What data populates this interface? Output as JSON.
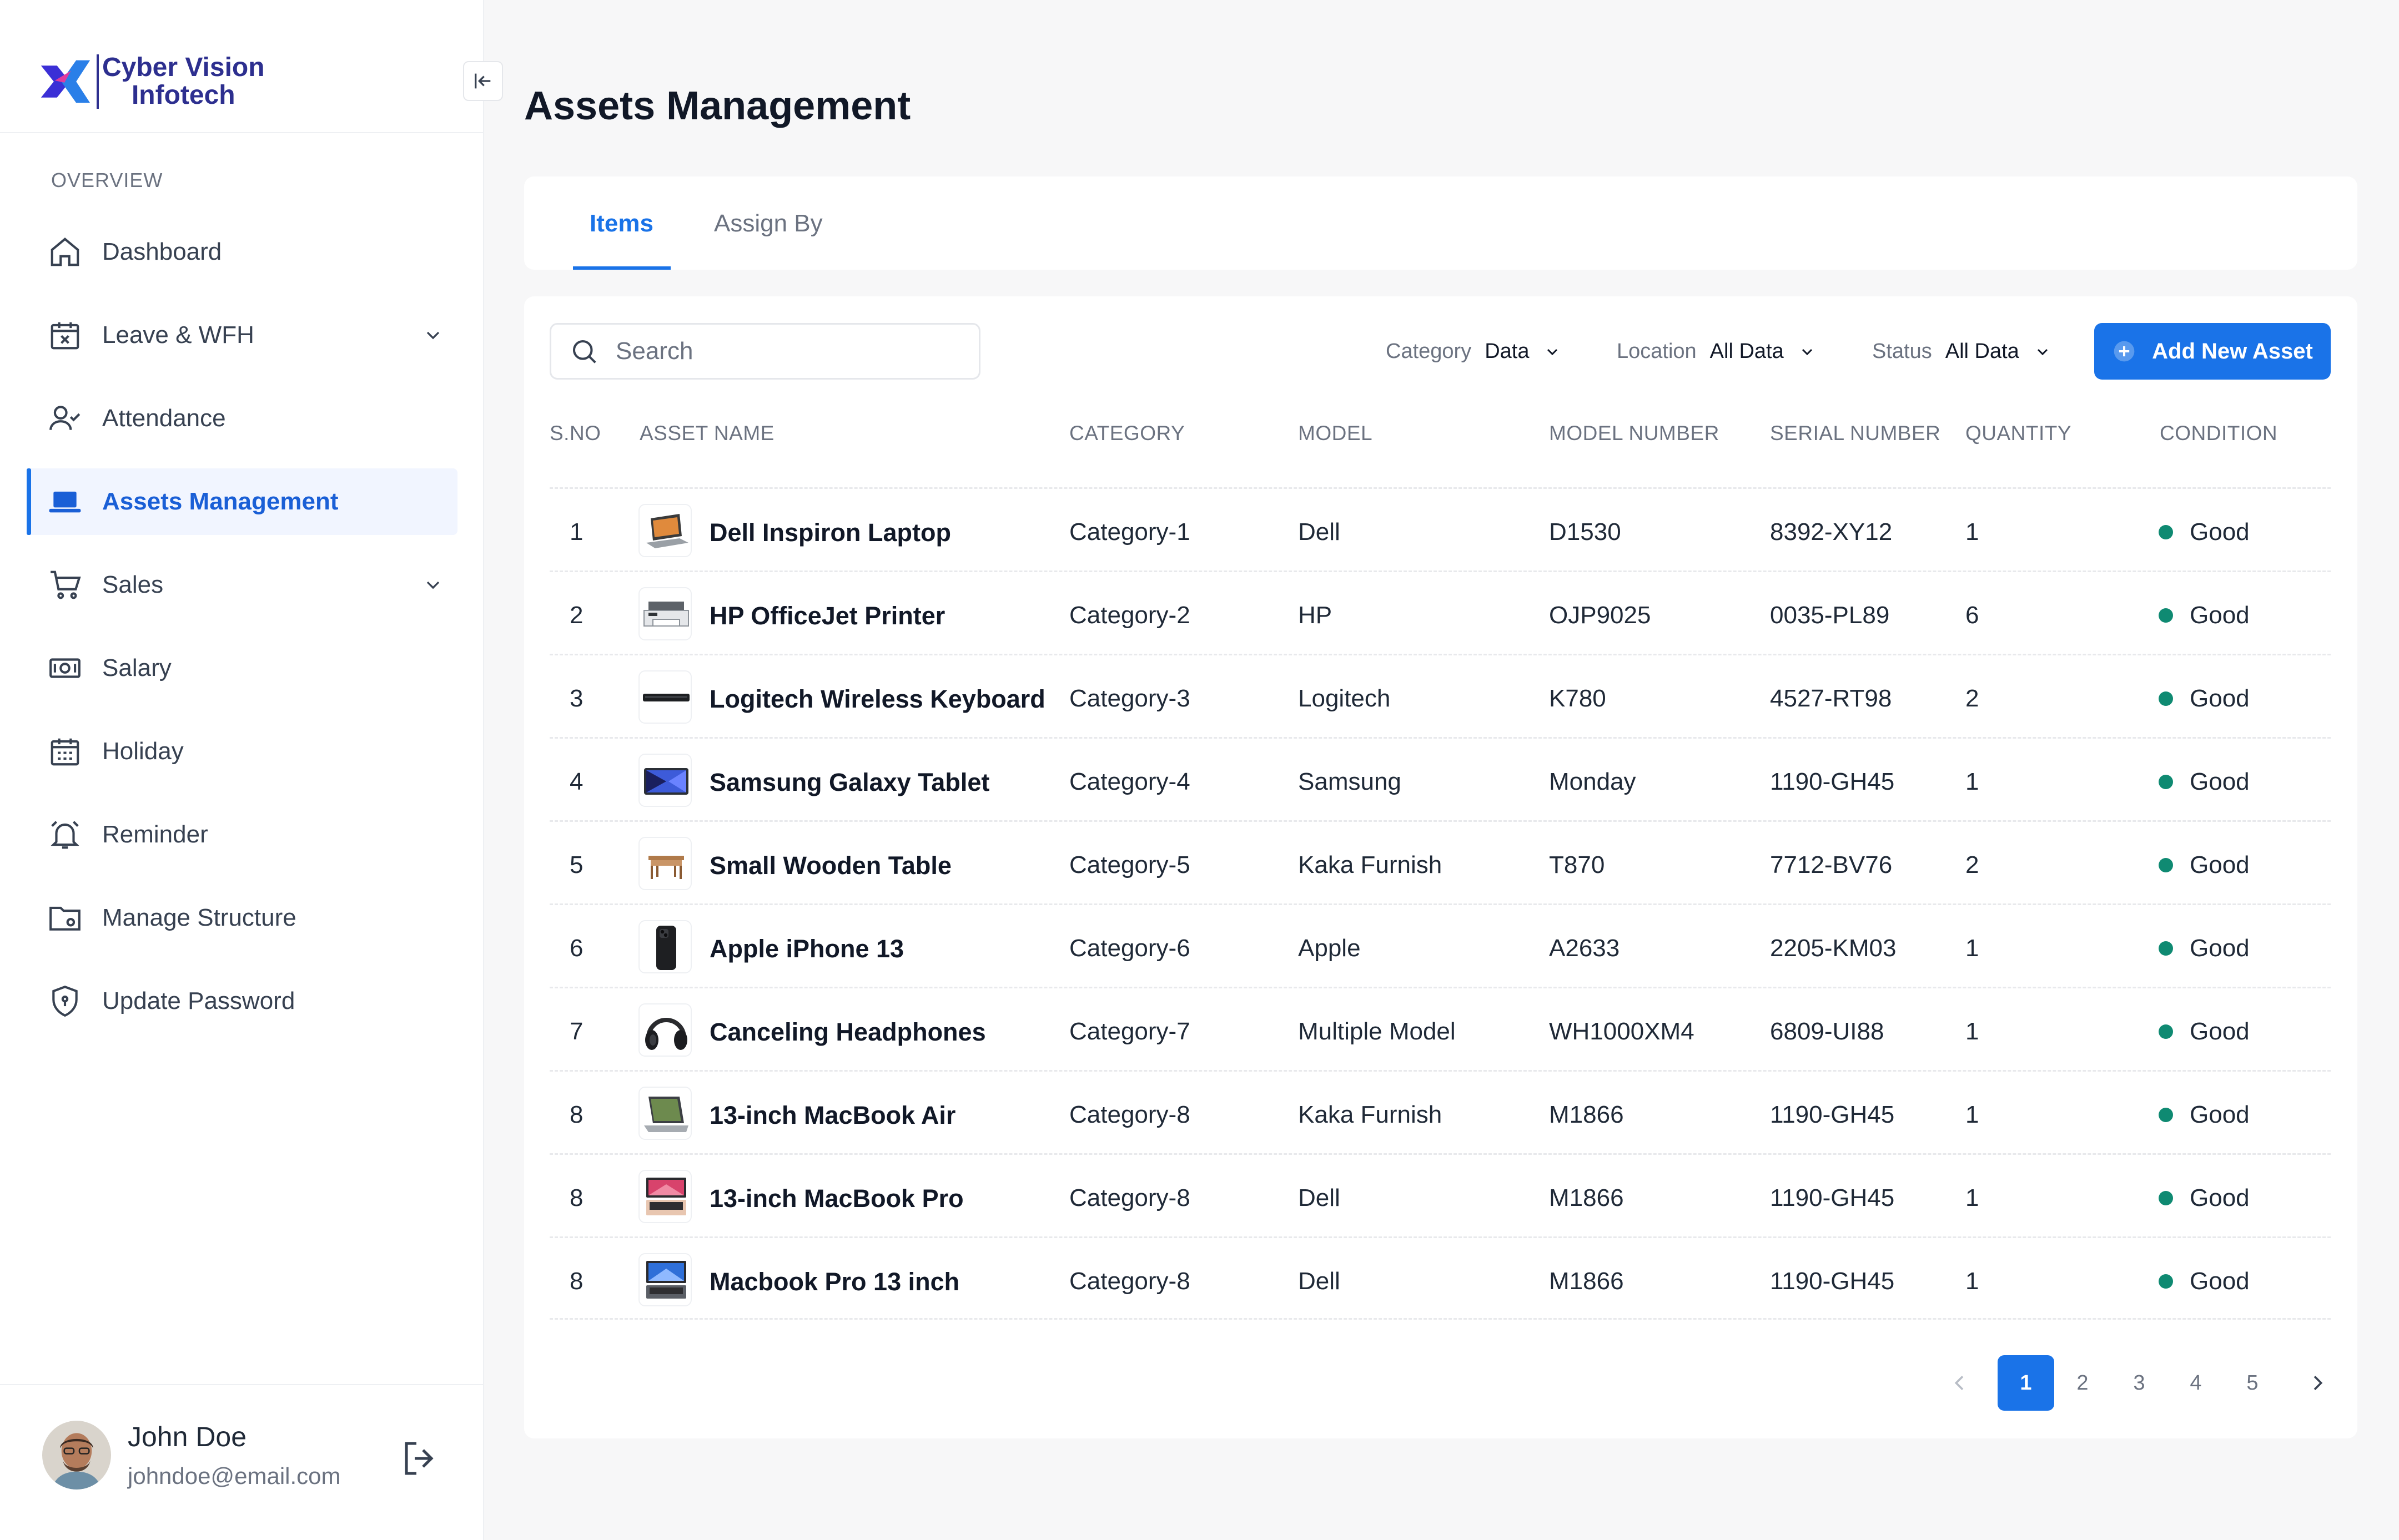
{
  "brand": {
    "line1": "Cyber Vision",
    "line2": "Infotech"
  },
  "sidebar": {
    "section_label": "OVERVIEW",
    "items": [
      {
        "label": "Dashboard",
        "icon": "home-icon"
      },
      {
        "label": "Leave & WFH",
        "icon": "calendar-x-icon",
        "expandable": true
      },
      {
        "label": "Attendance",
        "icon": "user-check-icon"
      },
      {
        "label": "Assets Management",
        "icon": "laptop-icon",
        "active": true
      },
      {
        "label": "Sales",
        "icon": "cart-icon",
        "expandable": true
      },
      {
        "label": "Salary",
        "icon": "money-icon"
      },
      {
        "label": "Holiday",
        "icon": "calendar-icon"
      },
      {
        "label": "Reminder",
        "icon": "bell-icon"
      },
      {
        "label": "Manage Structure",
        "icon": "folder-gear-icon"
      },
      {
        "label": "Update Password",
        "icon": "shield-lock-icon"
      }
    ]
  },
  "user": {
    "name": "John Doe",
    "email": "johndoe@email.com"
  },
  "page": {
    "title": "Assets Management"
  },
  "tabs": [
    {
      "label": "Items",
      "active": true
    },
    {
      "label": "Assign By",
      "active": false
    }
  ],
  "toolbar": {
    "search_placeholder": "Search",
    "filters": [
      {
        "label": "Category",
        "value": "Data"
      },
      {
        "label": "Location",
        "value": "All Data"
      },
      {
        "label": "Status",
        "value": "All Data"
      }
    ],
    "add_button_label": "Add New Asset"
  },
  "table": {
    "columns": [
      "S.NO",
      "ASSET NAME",
      "CATEGORY",
      "MODEL",
      "MODEL NUMBER",
      "SERIAL NUMBER",
      "QUANTITY",
      "CONDITION"
    ],
    "rows": [
      {
        "sno": "1",
        "name": "Dell Inspiron Laptop",
        "category": "Category-1",
        "model": "Dell",
        "model_number": "D1530",
        "serial": "8392-XY12",
        "qty": "1",
        "condition": "Good",
        "thumb": "laptop"
      },
      {
        "sno": "2",
        "name": "HP OfficeJet Printer",
        "category": "Category-2",
        "model": "HP",
        "model_number": "OJP9025",
        "serial": "0035-PL89",
        "qty": "6",
        "condition": "Good",
        "thumb": "printer"
      },
      {
        "sno": "3",
        "name": "Logitech Wireless Keyboard",
        "category": "Category-3",
        "model": "Logitech",
        "model_number": "K780",
        "serial": "4527-RT98",
        "qty": "2",
        "condition": "Good",
        "thumb": "keyboard"
      },
      {
        "sno": "4",
        "name": "Samsung Galaxy Tablet",
        "category": "Category-4",
        "model": "Samsung",
        "model_number": "Monday",
        "serial": "1190-GH45",
        "qty": "1",
        "condition": "Good",
        "thumb": "tablet"
      },
      {
        "sno": "5",
        "name": "Small Wooden Table",
        "category": "Category-5",
        "model": "Kaka Furnish",
        "model_number": "T870",
        "serial": "7712-BV76",
        "qty": "2",
        "condition": "Good",
        "thumb": "table"
      },
      {
        "sno": "6",
        "name": "Apple iPhone 13",
        "category": "Category-6",
        "model": "Apple",
        "model_number": "A2633",
        "serial": "2205-KM03",
        "qty": "1",
        "condition": "Good",
        "thumb": "phone"
      },
      {
        "sno": "7",
        "name": "Canceling Headphones",
        "category": "Category-7",
        "model": "Multiple Model",
        "model_number": "WH1000XM4",
        "serial": "6809-UI88",
        "qty": "1",
        "condition": "Good",
        "thumb": "headphones"
      },
      {
        "sno": "8",
        "name": "13-inch MacBook Air",
        "category": "Category-8",
        "model": "Kaka Furnish",
        "model_number": "M1866",
        "serial": "1190-GH45",
        "qty": "1",
        "condition": "Good",
        "thumb": "macbook-air"
      },
      {
        "sno": "8",
        "name": "13-inch MacBook Pro",
        "category": "Category-8",
        "model": "Dell",
        "model_number": "M1866",
        "serial": "1190-GH45",
        "qty": "1",
        "condition": "Good",
        "thumb": "macbook-pro"
      },
      {
        "sno": "8",
        "name": "Macbook Pro 13 inch",
        "category": "Category-8",
        "model": "Dell",
        "model_number": "M1866",
        "serial": "1190-GH45",
        "qty": "1",
        "condition": "Good",
        "thumb": "macbook-pro-blue"
      }
    ]
  },
  "pagination": {
    "pages": [
      "1",
      "2",
      "3",
      "4",
      "5"
    ],
    "current": "1"
  },
  "colors": {
    "accent": "#1a73e8",
    "brand": "#2d2f8f",
    "good": "#0f8a72"
  }
}
